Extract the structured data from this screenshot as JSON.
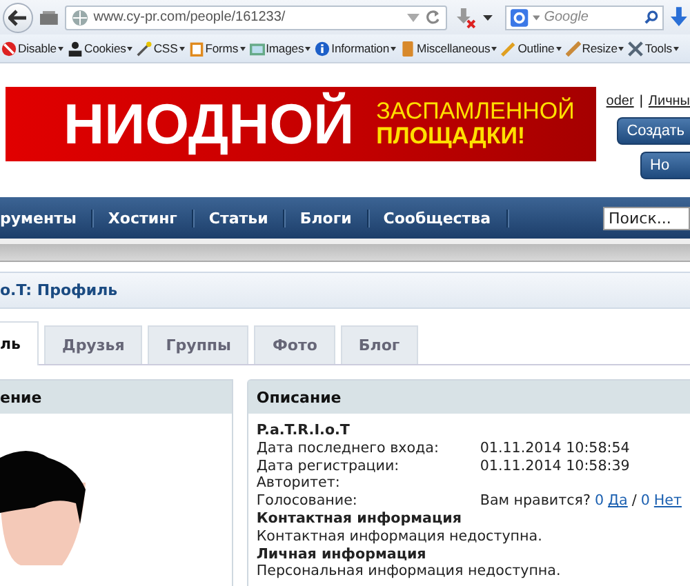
{
  "browser": {
    "url": "www.cy-pr.com/people/161233/",
    "search_placeholder": "Google"
  },
  "dev_toolbar": [
    {
      "label": "Disable"
    },
    {
      "label": "Cookies"
    },
    {
      "label": "CSS"
    },
    {
      "label": "Forms"
    },
    {
      "label": "Images"
    },
    {
      "label": "Information"
    },
    {
      "label": "Miscellaneous"
    },
    {
      "label": "Outline"
    },
    {
      "label": "Resize"
    },
    {
      "label": "Tools"
    }
  ],
  "banner": {
    "big": "НИОДНОЙ",
    "line_1": "ЗАСПАМЛЕННОЙ",
    "line_2": "ПЛОЩАДКИ!"
  },
  "header": {
    "links": [
      "oder",
      "Личны"
    ],
    "link_separator": "|",
    "buttons": [
      "Создать",
      "Но"
    ]
  },
  "nav": {
    "items": [
      "рументы",
      "Хостинг",
      "Статьи",
      "Блоги",
      "Сообщества"
    ],
    "search_placeholder": "Поиск..."
  },
  "page_title": "o.T: Профиль",
  "tabs": [
    {
      "label": "ль",
      "selected": true
    },
    {
      "label": "Друзья",
      "selected": false
    },
    {
      "label": "Группы",
      "selected": false
    },
    {
      "label": "Фото",
      "selected": false
    },
    {
      "label": "Блог",
      "selected": false
    }
  ],
  "left_panel": {
    "title": "ение"
  },
  "right_panel": {
    "title": "Описание",
    "name": "P.a.T.R.I.o.T",
    "rows": [
      {
        "kind": "field",
        "label": "Дата последнего входа:",
        "value": "01.11.2014 10:58:54"
      },
      {
        "kind": "field",
        "label": "Дата регистрации:",
        "value": "01.11.2014 10:58:39"
      },
      {
        "kind": "field",
        "label": "Авторитет:"
      },
      {
        "kind": "vote",
        "label": "Голосование:",
        "question": "Вам нравится?",
        "yes_count": "0",
        "yes": "Да",
        "separator": "/",
        "no_count": "0",
        "no": "Нет"
      },
      {
        "kind": "heading",
        "label": "Контактная информация"
      },
      {
        "kind": "text",
        "label": "Контактная информация недоступна."
      },
      {
        "kind": "heading",
        "label": "Личная информация"
      },
      {
        "kind": "text",
        "label": "Персональная информация недоступна."
      }
    ]
  }
}
